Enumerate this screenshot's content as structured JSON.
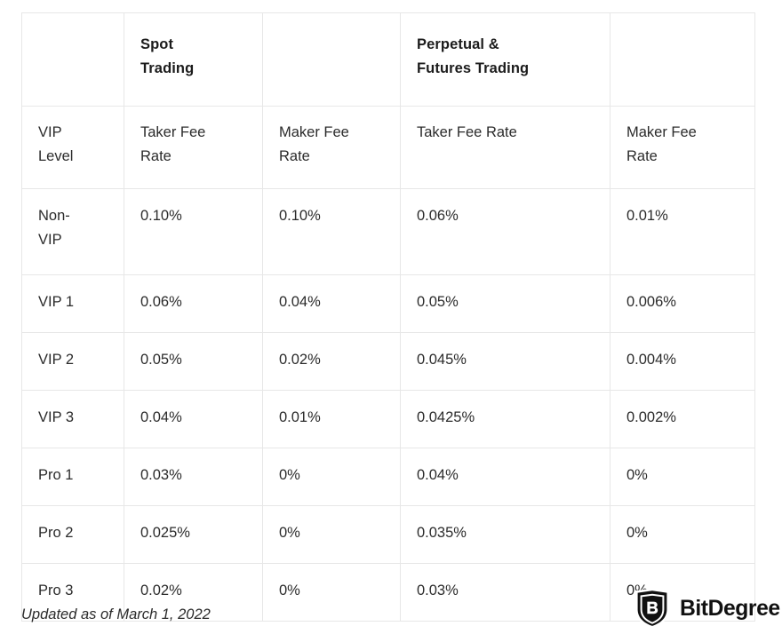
{
  "table": {
    "group_headers": {
      "level_blank": "",
      "spot": "Spot\nTrading",
      "spot_blank": "",
      "perpetual": "Perpetual &\nFutures Trading",
      "perpetual_blank": ""
    },
    "column_headers": {
      "level": "VIP\nLevel",
      "spot_taker": "Taker Fee\nRate",
      "spot_maker": "Maker Fee\nRate",
      "perp_taker": "Taker Fee Rate",
      "perp_maker": "Maker Fee\nRate"
    },
    "rows": [
      {
        "level": "Non-\nVIP",
        "spot_taker": "0.10%",
        "spot_maker": "0.10%",
        "perp_taker": "0.06%",
        "perp_maker": "0.01%",
        "tall": true
      },
      {
        "level": "VIP 1",
        "spot_taker": "0.06%",
        "spot_maker": "0.04%",
        "perp_taker": "0.05%",
        "perp_maker": "0.006%",
        "tall": false
      },
      {
        "level": "VIP 2",
        "spot_taker": "0.05%",
        "spot_maker": "0.02%",
        "perp_taker": "0.045%",
        "perp_maker": "0.004%",
        "tall": false
      },
      {
        "level": "VIP 3",
        "spot_taker": "0.04%",
        "spot_maker": "0.01%",
        "perp_taker": "0.0425%",
        "perp_maker": "0.002%",
        "tall": false
      },
      {
        "level": "Pro 1",
        "spot_taker": "0.03%",
        "spot_maker": "0%",
        "perp_taker": "0.04%",
        "perp_maker": "0%",
        "tall": false
      },
      {
        "level": "Pro 2",
        "spot_taker": "0.025%",
        "spot_maker": "0%",
        "perp_taker": "0.035%",
        "perp_maker": "0%",
        "tall": false
      },
      {
        "level": "Pro 3",
        "spot_taker": "0.02%",
        "spot_maker": "0%",
        "perp_taker": "0.03%",
        "perp_maker": "0%",
        "tall": false
      }
    ]
  },
  "caption": "Updated as of March 1, 2022",
  "branding": {
    "name": "BitDegree",
    "mark_letter": "B",
    "mark_icon": "shield-b-logo-icon",
    "color": "#111111"
  },
  "colors": {
    "text": "#2b2b2b",
    "heading": "#1c1c1c",
    "grid": "#e7e7e7",
    "background": "#ffffff"
  }
}
